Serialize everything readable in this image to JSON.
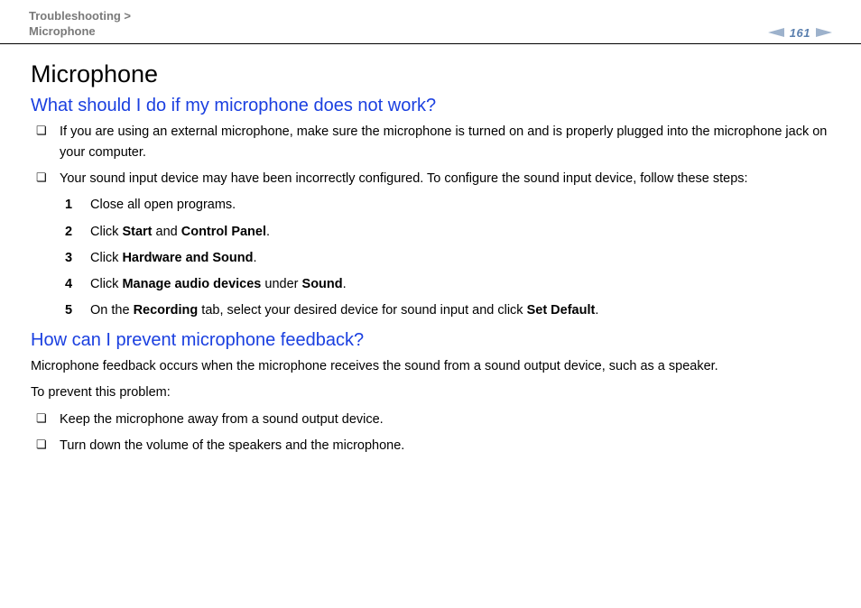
{
  "header": {
    "crumb1": "Troubleshooting >",
    "crumb2": "Microphone",
    "pageNumber": "161"
  },
  "main": {
    "title": "Microphone",
    "q1": "What should I do if my microphone does not work?",
    "q1_b1": "If you are using an external microphone, make sure the microphone is turned on and is properly plugged into the microphone jack on your computer.",
    "q1_b2": "Your sound input device may have been incorrectly configured. To configure the sound input device, follow these steps:",
    "steps": {
      "s1": "Close all open programs.",
      "s2_pre": "Click ",
      "s2_b1": "Start",
      "s2_mid": " and ",
      "s2_b2": "Control Panel",
      "s2_post": ".",
      "s3_pre": "Click ",
      "s3_b1": "Hardware and Sound",
      "s3_post": ".",
      "s4_pre": "Click ",
      "s4_b1": "Manage audio devices",
      "s4_mid": " under ",
      "s4_b2": "Sound",
      "s4_post": ".",
      "s5_pre": "On the ",
      "s5_b1": "Recording",
      "s5_mid": " tab, select your desired device for sound input and click ",
      "s5_b2": "Set Default",
      "s5_post": "."
    },
    "q2": "How can I prevent microphone feedback?",
    "q2_p1": "Microphone feedback occurs when the microphone receives the sound from a sound output device, such as a speaker.",
    "q2_p2": "To prevent this problem:",
    "q2_b1": "Keep the microphone away from a sound output device.",
    "q2_b2": "Turn down the volume of the speakers and the microphone."
  }
}
